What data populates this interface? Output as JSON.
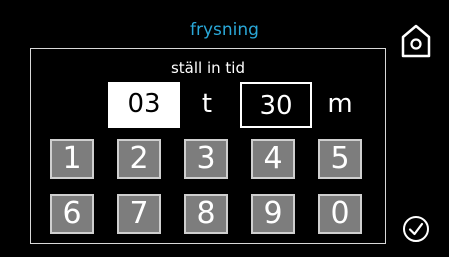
{
  "header": {
    "title": "frysning",
    "title_color": "#2aa8d8",
    "home_icon": "home-icon"
  },
  "panel": {
    "subtitle": "ställ in tid"
  },
  "time": {
    "hours_value": "03",
    "hours_unit": "t",
    "minutes_value": "30",
    "minutes_unit": "m"
  },
  "keypad": {
    "row1": [
      "1",
      "2",
      "3",
      "4",
      "5"
    ],
    "row2": [
      "6",
      "7",
      "8",
      "9",
      "0"
    ]
  },
  "footer": {
    "confirm_icon": "checkmark-circle-icon"
  }
}
